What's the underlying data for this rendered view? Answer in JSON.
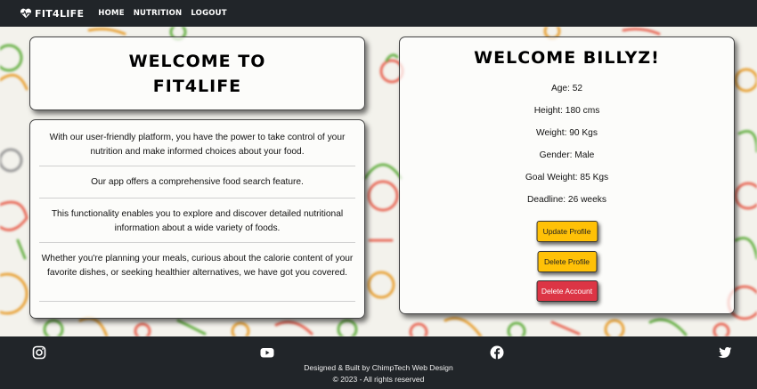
{
  "navbar": {
    "brand": "FIT4LIFE",
    "links": [
      "HOME",
      "NUTRITION",
      "LOGOUT"
    ]
  },
  "welcome": {
    "line1": "WELCOME TO",
    "line2": "FIT4LIFE"
  },
  "info": [
    "With our user-friendly platform, you have the power to take control of your nutrition and make informed choices about your food.",
    "Our app offers a comprehensive food search feature.",
    "This functionality enables you to explore and discover detailed nutritional information about a wide variety of foods.",
    "Whether you're planning your meals, curious about the calorie content of your favorite dishes, or seeking healthier alternatives, we have got you covered."
  ],
  "profile": {
    "title": "WELCOME BILLYZ!",
    "details": [
      "Age: 52",
      "Height: 180 cms",
      "Weight: 90 Kgs",
      "Gender: Male",
      "Goal Weight: 85 Kgs",
      "Deadline: 26 weeks"
    ],
    "buttons": {
      "update": "Update Profile",
      "delete_profile": "Delete Profile",
      "delete_account": "Delete Account"
    }
  },
  "footer": {
    "icons": [
      "instagram-icon",
      "youtube-icon",
      "facebook-icon",
      "twitter-icon"
    ],
    "credit": "Designed & Built by ChimpTech Web Design",
    "copyright": "© 2023 - All rights reserved"
  },
  "colors": {
    "nav_bg": "#212529",
    "warning": "#ffc107",
    "danger": "#dc3545"
  }
}
